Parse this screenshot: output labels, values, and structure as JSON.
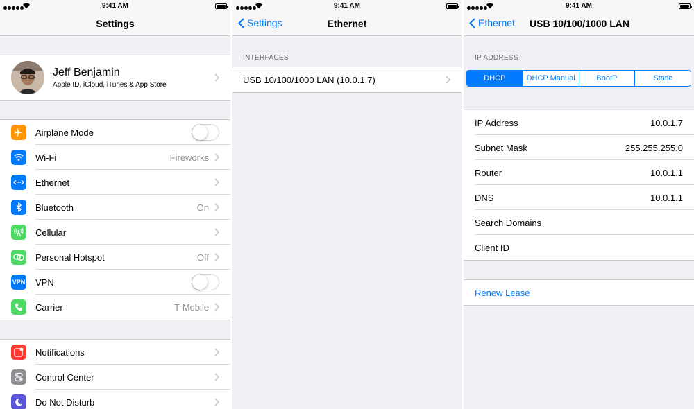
{
  "status_bar": {
    "time": "9:41 AM"
  },
  "settings": {
    "title": "Settings",
    "profile": {
      "name": "Jeff Benjamin",
      "subtitle": "Apple ID, iCloud, iTunes & App Store"
    },
    "group1": [
      {
        "label": "Airplane Mode",
        "icon": "airplane-icon",
        "color": "#ff9500",
        "control": "toggle",
        "on": false
      },
      {
        "label": "Wi-Fi",
        "icon": "wifi-icon",
        "color": "#007aff",
        "value": "Fireworks"
      },
      {
        "label": "Ethernet",
        "icon": "ethernet-icon",
        "color": "#007aff",
        "value": ""
      },
      {
        "label": "Bluetooth",
        "icon": "bluetooth-icon",
        "color": "#007aff",
        "value": "On"
      },
      {
        "label": "Cellular",
        "icon": "cellular-icon",
        "color": "#4cd964",
        "value": ""
      },
      {
        "label": "Personal Hotspot",
        "icon": "hotspot-icon",
        "color": "#4cd964",
        "value": "Off"
      },
      {
        "label": "VPN",
        "icon": "vpn-icon",
        "icon_text": "VPN",
        "color": "#007aff",
        "control": "toggle",
        "on": false
      },
      {
        "label": "Carrier",
        "icon": "phone-icon",
        "color": "#4cd964",
        "value": "T-Mobile"
      }
    ],
    "group2": [
      {
        "label": "Notifications",
        "icon": "notifications-icon",
        "color": "#ff3b30"
      },
      {
        "label": "Control Center",
        "icon": "control-center-icon",
        "color": "#8e8e93"
      },
      {
        "label": "Do Not Disturb",
        "icon": "moon-icon",
        "color": "#5856d6"
      }
    ]
  },
  "ethernet": {
    "back_label": "Settings",
    "title": "Ethernet",
    "section_header": "INTERFACES",
    "interface_label": "USB 10/100/1000 LAN (10.0.1.7)"
  },
  "lan": {
    "back_label": "Ethernet",
    "title": "USB 10/100/1000 LAN",
    "section_header": "IP ADDRESS",
    "segments": [
      "DHCP",
      "DHCP Manual",
      "BootP",
      "Static"
    ],
    "selected_segment": "DHCP",
    "fields": [
      {
        "label": "IP Address",
        "value": "10.0.1.7"
      },
      {
        "label": "Subnet Mask",
        "value": "255.255.255.0"
      },
      {
        "label": "Router",
        "value": "10.0.1.1"
      },
      {
        "label": "DNS",
        "value": "10.0.1.1"
      },
      {
        "label": "Search Domains",
        "value": ""
      },
      {
        "label": "Client ID",
        "value": ""
      }
    ],
    "renew_label": "Renew Lease"
  },
  "colors": {
    "accent": "#007aff",
    "background": "#efeff4"
  }
}
